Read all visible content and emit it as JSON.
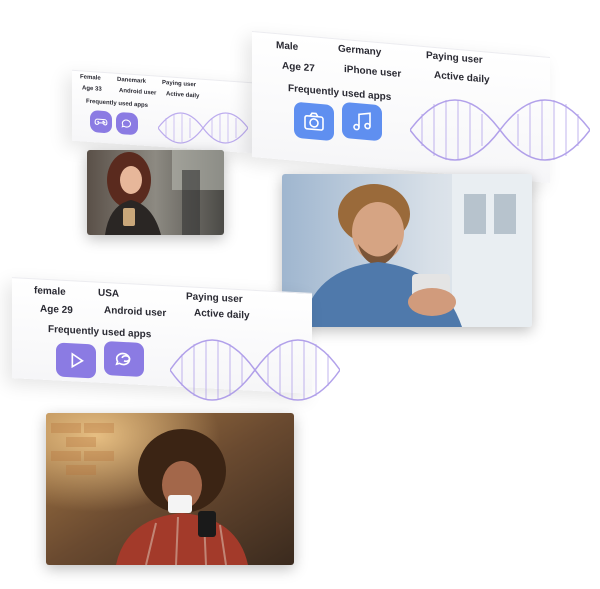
{
  "profiles": [
    {
      "gender": "Female",
      "country": "Danemark",
      "status": "Paying user",
      "age": "Age 33",
      "device": "Android user",
      "activity": "Active daily",
      "apps_label": "Frequently used apps",
      "apps": [
        "gamepad-icon",
        "chat-icon"
      ]
    },
    {
      "gender": "Male",
      "country": "Germany",
      "status": "Paying user",
      "age": "Age 27",
      "device": "iPhone user",
      "activity": "Active daily",
      "apps_label": "Frequently used apps",
      "apps": [
        "camera-icon",
        "music-icon"
      ]
    },
    {
      "gender": "female",
      "country": "USA",
      "status": "Paying user",
      "age": "Age 29",
      "device": "Android user",
      "activity": "Active daily",
      "apps_label": "Frequently used apps",
      "apps": [
        "play-icon",
        "chat-icon"
      ]
    }
  ],
  "colors": {
    "app_purple": "#8b7be3",
    "app_blue": "#5f8ff0",
    "dna": "#9e86e6"
  }
}
